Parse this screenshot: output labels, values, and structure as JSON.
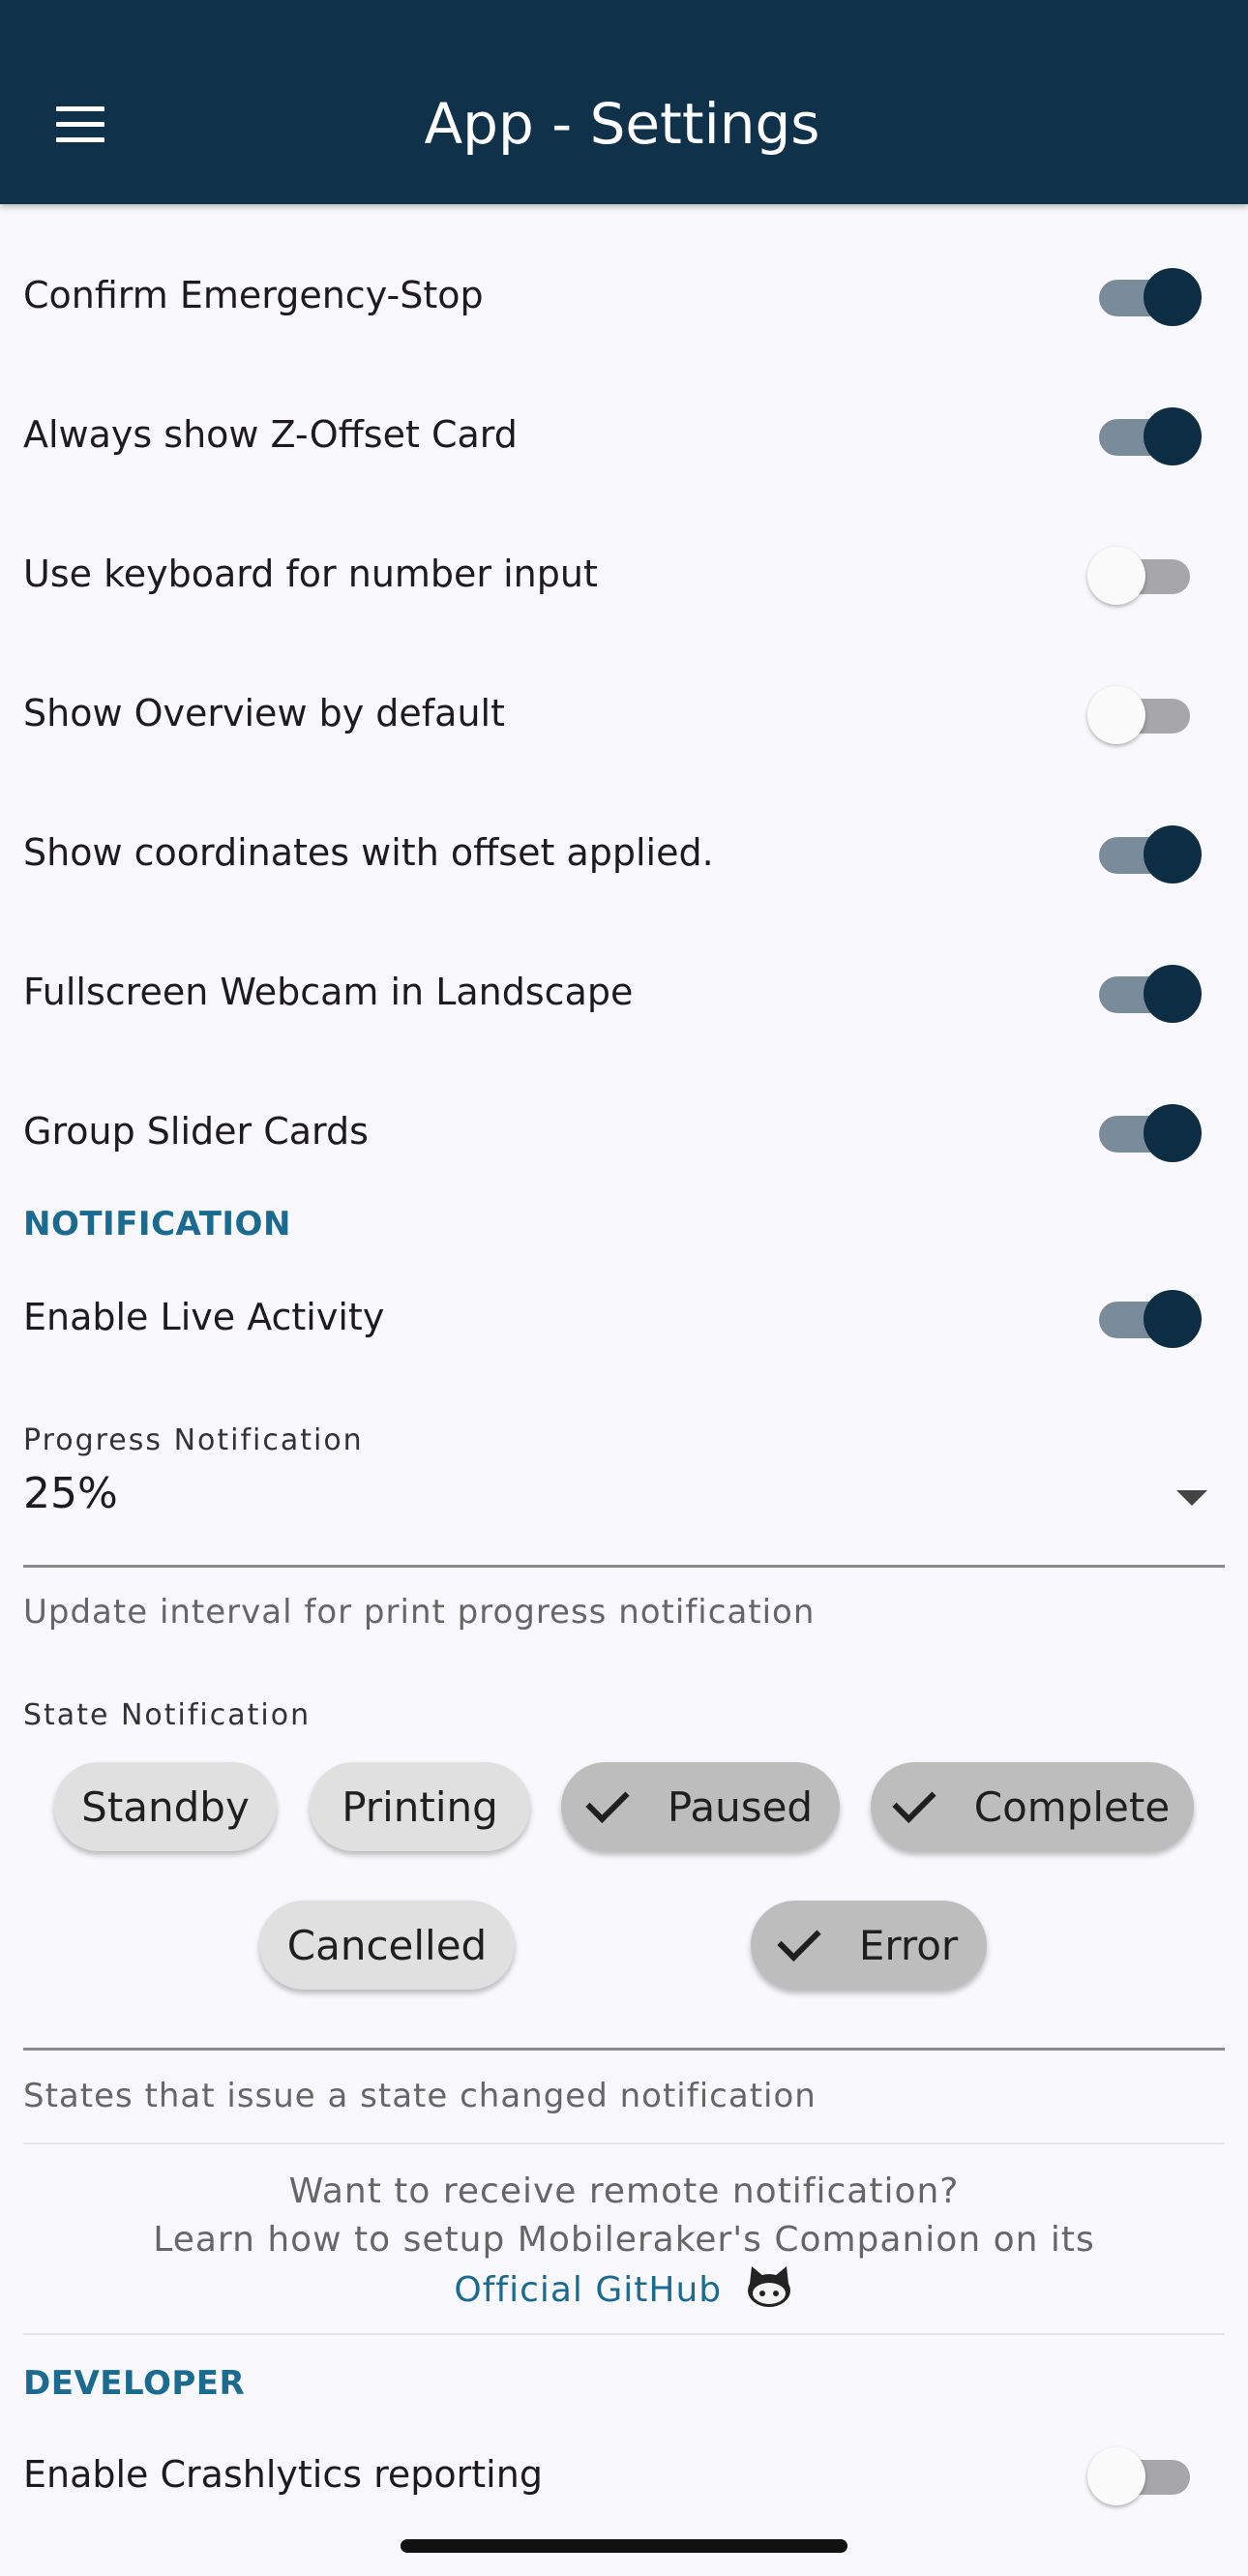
{
  "appbar": {
    "title": "App - Settings"
  },
  "settings": [
    {
      "label": "Confirm Emergency-Stop",
      "on": true
    },
    {
      "label": "Always show Z-Offset Card",
      "on": true
    },
    {
      "label": "Use keyboard for number input",
      "on": false
    },
    {
      "label": "Show Overview by default",
      "on": false
    },
    {
      "label": "Show coordinates with offset applied.",
      "on": true
    },
    {
      "label": "Fullscreen Webcam in Landscape",
      "on": true
    },
    {
      "label": "Group Slider Cards",
      "on": true
    }
  ],
  "notification": {
    "header": "NOTIFICATION",
    "live_activity": {
      "label": "Enable Live Activity",
      "on": true
    },
    "progress": {
      "label": "Progress Notification",
      "value": "25%",
      "helper": "Update interval for print progress notification"
    },
    "state": {
      "label": "State Notification",
      "chips": [
        {
          "label": "Standby",
          "selected": false
        },
        {
          "label": "Printing",
          "selected": false
        },
        {
          "label": "Paused",
          "selected": true
        },
        {
          "label": "Complete",
          "selected": true
        },
        {
          "label": "Cancelled",
          "selected": false
        },
        {
          "label": "Error",
          "selected": true
        }
      ],
      "helper": "States that issue a state changed notification"
    },
    "remote": {
      "line1": "Want to receive remote notification?",
      "line2": "Learn how to setup Mobileraker's Companion on its",
      "link": "Official GitHub",
      "icon": "github-icon"
    }
  },
  "developer": {
    "header": "DEVELOPER",
    "crashlytics": {
      "label": "Enable Crashlytics reporting",
      "on": false
    }
  },
  "colors": {
    "appbar": "#0f3149",
    "accent": "#1b6a8f",
    "switch_on": "#0d2d45"
  }
}
